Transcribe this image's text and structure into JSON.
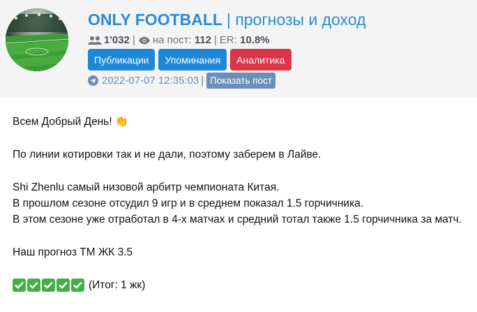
{
  "channel": {
    "name": "ONLY FOOTBALL",
    "divider": "|",
    "description": "прогнозы и доход"
  },
  "stats": {
    "subscribers": "1'032",
    "per_post_label": "на пост:",
    "per_post": "112",
    "er_label": "ER:",
    "er": "10.8%",
    "icons": [
      "users-icon",
      "eye-icon"
    ]
  },
  "buttons": {
    "publications": "Публикации",
    "mentions": "Упоминания",
    "analytics": "Аналитика",
    "show_post": "Показать пост"
  },
  "post_meta": {
    "datetime": "2022-07-07 12:35:03",
    "icon": "telegram-icon"
  },
  "post": {
    "greeting": "Всем Добрый День! 👏",
    "line1": "По линии котировки так и не дали, поэтому заберем в Лайве.",
    "line2": "Shi Zhenlu самый низовой арбитр чемпионата Китая.",
    "line3": "В прошлом сезоне отсудил 9 игр и в среднем показал 1.5 горчичника.",
    "line4": "В этом сезоне уже отработал в 4-х матчах и средний тотал также 1.5 горчичника за матч.",
    "forecast": "Наш прогноз ТМ ЖК 3.5",
    "result": "(Итог: 1 жк)",
    "checks_count": 5
  },
  "colors": {
    "title": "#2a8bd3",
    "button_blue": "#1e88d6",
    "button_red": "#dc3545",
    "button_gray_blue": "#6c8fb8",
    "check_green": "#43b047",
    "header_bg": "#f4f4f4"
  }
}
